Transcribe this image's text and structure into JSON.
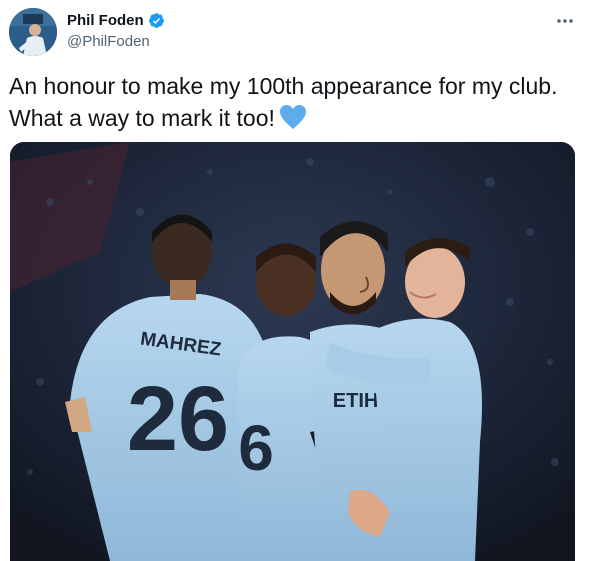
{
  "author": {
    "display_name": "Phil Foden",
    "handle": "@PhilFoden",
    "verified": true,
    "avatar_icon": "avatar-photo"
  },
  "tweet": {
    "line1": "An honour to make my 100th appearance for my club.",
    "line2": "What a way to mark it too!",
    "emoji": "blue-heart-icon"
  },
  "media": {
    "jersey_name": "MAHREZ",
    "jersey_number": "26",
    "second_number": "6",
    "sponsor_text": "ETIHAD"
  },
  "colors": {
    "verified_blue": "#1d9bf0",
    "heart_blue": "#5dadec",
    "kit_sky_blue": "#a8cce6"
  }
}
